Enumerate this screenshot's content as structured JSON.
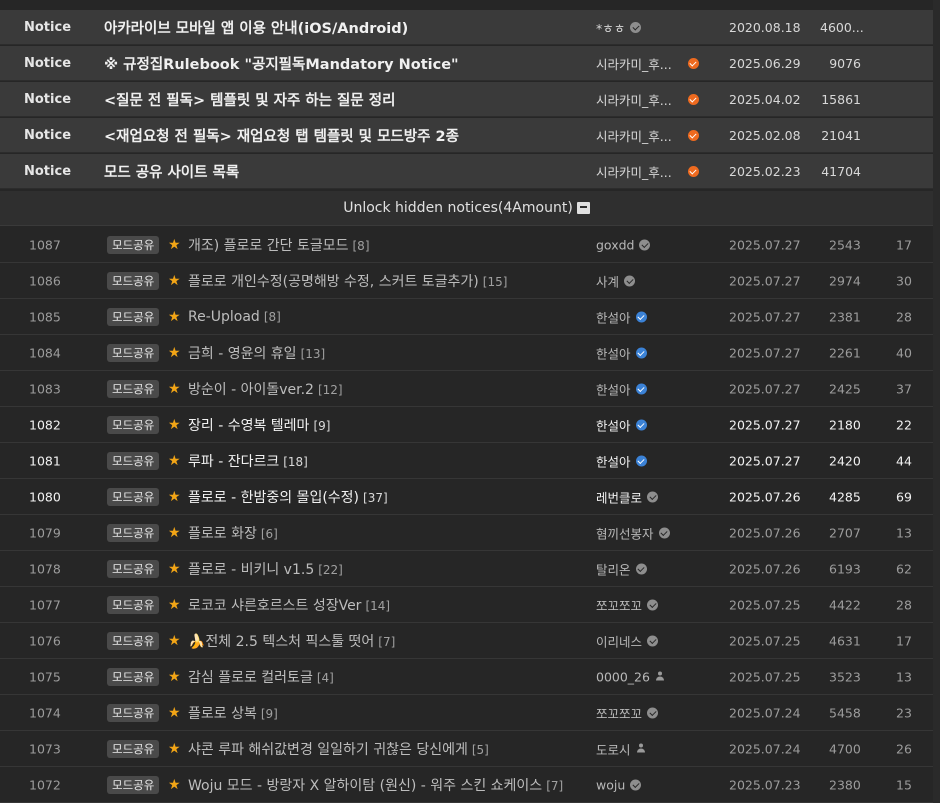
{
  "notices": [
    {
      "category": "Notice",
      "title": "아카라이브 모바일 앱 이용 안내(iOS/Android)",
      "author": "*ㅎㅎ",
      "badge": "gray",
      "date": "2020.08.18",
      "views": "4600..."
    },
    {
      "category": "Notice",
      "title": "※ 규정집Rulebook \"공지필독Mandatory Notice\"",
      "author": "시라카미_후...",
      "badge": "orange",
      "date": "2025.06.29",
      "views": "9076"
    },
    {
      "category": "Notice",
      "title": "<질문 전 필독> 템플릿 및 자주 하는 질문 정리",
      "author": "시라카미_후...",
      "badge": "orange",
      "date": "2025.04.02",
      "views": "15861"
    },
    {
      "category": "Notice",
      "title": "<재업요청 전 필독> 재업요청 탭 템플릿 및 모드방주 2종",
      "author": "시라카미_후...",
      "badge": "orange",
      "date": "2025.02.08",
      "views": "21041"
    },
    {
      "category": "Notice",
      "title": "모드 공유 사이트 목록",
      "author": "시라카미_후...",
      "badge": "orange",
      "date": "2025.02.23",
      "views": "41704"
    }
  ],
  "unlock": {
    "label": "Unlock hidden notices(4Amount)",
    "icon": "archive-icon"
  },
  "posts": [
    {
      "num": "1087",
      "badge": "모드공유",
      "title": "개조) 플로로 간단 토글모드",
      "comments": "[8]",
      "author": "goxdd",
      "icon": "gray",
      "date": "2025.07.27",
      "views": "2543",
      "recs": "17",
      "bright": false
    },
    {
      "num": "1086",
      "badge": "모드공유",
      "title": "플로로 개인수정(공명해방 수정, 스커트 토글추가)",
      "comments": "[15]",
      "author": "사계",
      "icon": "gray",
      "date": "2025.07.27",
      "views": "2974",
      "recs": "30",
      "bright": false
    },
    {
      "num": "1085",
      "badge": "모드공유",
      "title": "Re-Upload",
      "comments": "[8]",
      "author": "한설아",
      "icon": "blue",
      "date": "2025.07.27",
      "views": "2381",
      "recs": "28",
      "bright": false
    },
    {
      "num": "1084",
      "badge": "모드공유",
      "title": "금희 - 영윤의 휴일",
      "comments": "[13]",
      "author": "한설아",
      "icon": "blue",
      "date": "2025.07.27",
      "views": "2261",
      "recs": "40",
      "bright": false
    },
    {
      "num": "1083",
      "badge": "모드공유",
      "title": "방순이 - 아이돌ver.2",
      "comments": "[12]",
      "author": "한설아",
      "icon": "blue",
      "date": "2025.07.27",
      "views": "2425",
      "recs": "37",
      "bright": false
    },
    {
      "num": "1082",
      "badge": "모드공유",
      "title": "장리 - 수영복 텔레마",
      "comments": "[9]",
      "author": "한설아",
      "icon": "blue",
      "date": "2025.07.27",
      "views": "2180",
      "recs": "22",
      "bright": true
    },
    {
      "num": "1081",
      "badge": "모드공유",
      "title": "루파 - 잔다르크",
      "comments": "[18]",
      "author": "한설아",
      "icon": "blue",
      "date": "2025.07.27",
      "views": "2420",
      "recs": "44",
      "bright": true
    },
    {
      "num": "1080",
      "badge": "모드공유",
      "title": "플로로 - 한밤중의 몰입(수정)",
      "comments": "[37]",
      "author": "레번클로",
      "icon": "gray",
      "date": "2025.07.26",
      "views": "4285",
      "recs": "69",
      "bright": true
    },
    {
      "num": "1079",
      "badge": "모드공유",
      "title": "플로로 화장",
      "comments": "[6]",
      "author": "혐끼선봉자",
      "icon": "gray",
      "date": "2025.07.26",
      "views": "2707",
      "recs": "13",
      "bright": false
    },
    {
      "num": "1078",
      "badge": "모드공유",
      "title": "플로로 - 비키니 v1.5",
      "comments": "[22]",
      "author": "탈리온",
      "icon": "gray",
      "date": "2025.07.26",
      "views": "6193",
      "recs": "62",
      "bright": false
    },
    {
      "num": "1077",
      "badge": "모드공유",
      "title": "로코코 샤른호르스트 성장Ver",
      "comments": "[14]",
      "author": "쪼꼬쪼꼬",
      "icon": "gray",
      "date": "2025.07.25",
      "views": "4422",
      "recs": "28",
      "bright": false
    },
    {
      "num": "1076",
      "badge": "모드공유",
      "title": "🍌전체 2.5 텍스처 픽스툴 떳어",
      "comments": "[7]",
      "author": "이리네스",
      "icon": "gray",
      "date": "2025.07.25",
      "views": "4631",
      "recs": "17",
      "bright": false
    },
    {
      "num": "1075",
      "badge": "모드공유",
      "title": "감심 플로로 컬러토글",
      "comments": "[4]",
      "author": "0000_26",
      "icon": "user",
      "date": "2025.07.25",
      "views": "3523",
      "recs": "13",
      "bright": false
    },
    {
      "num": "1074",
      "badge": "모드공유",
      "title": "플로로 상복",
      "comments": "[9]",
      "author": "쪼꼬쪼꼬",
      "icon": "gray",
      "date": "2025.07.24",
      "views": "5458",
      "recs": "23",
      "bright": false
    },
    {
      "num": "1073",
      "badge": "모드공유",
      "title": "샤콘 루파 해쉬값변경 일일하기 귀찮은 당신에게",
      "comments": "[5]",
      "author": "도로시",
      "icon": "user",
      "date": "2025.07.24",
      "views": "4700",
      "recs": "26",
      "bright": false
    },
    {
      "num": "1072",
      "badge": "모드공유",
      "title": "Woju 모드 - 방랑자 X 알하이탐 (원신) - 워주 스킨 쇼케이스",
      "comments": "[7]",
      "author": "woju",
      "icon": "gray",
      "date": "2025.07.23",
      "views": "2380",
      "recs": "15",
      "bright": false
    }
  ]
}
